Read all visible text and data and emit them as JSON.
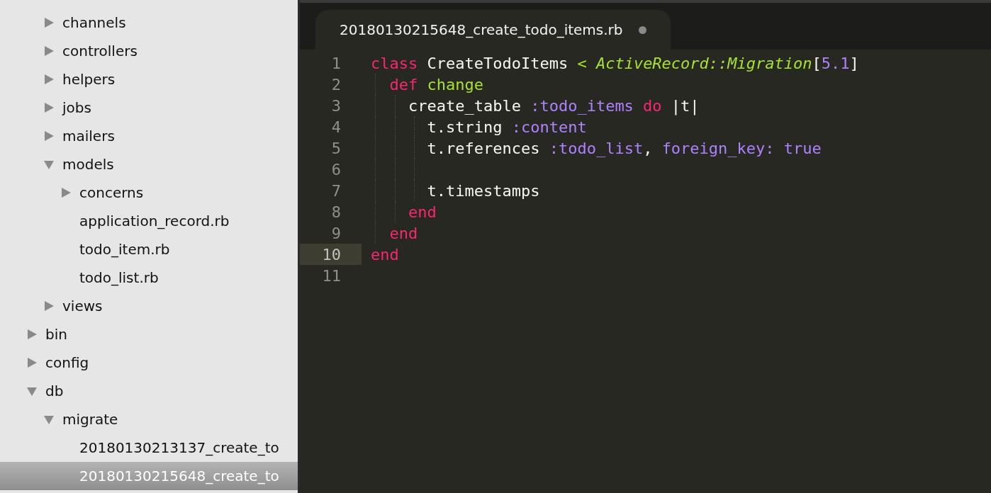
{
  "sidebar": {
    "tree": [
      {
        "children": [
          {
            "label": "channels",
            "kind": "folder",
            "expanded": false,
            "selected": false
          },
          {
            "label": "controllers",
            "kind": "folder",
            "expanded": false,
            "selected": false
          },
          {
            "label": "helpers",
            "kind": "folder",
            "expanded": false,
            "selected": false
          },
          {
            "label": "jobs",
            "kind": "folder",
            "expanded": false,
            "selected": false
          },
          {
            "label": "mailers",
            "kind": "folder",
            "expanded": false,
            "selected": false
          },
          {
            "label": "models",
            "kind": "folder",
            "expanded": true,
            "selected": false,
            "children": [
              {
                "label": "concerns",
                "kind": "folder",
                "expanded": false,
                "selected": false
              },
              {
                "label": "application_record.rb",
                "kind": "file",
                "selected": false
              },
              {
                "label": "todo_item.rb",
                "kind": "file",
                "selected": false
              },
              {
                "label": "todo_list.rb",
                "kind": "file",
                "selected": false
              }
            ]
          },
          {
            "label": "views",
            "kind": "folder",
            "expanded": false,
            "selected": false
          }
        ]
      },
      {
        "label": "bin",
        "kind": "folder",
        "expanded": false,
        "selected": false
      },
      {
        "label": "config",
        "kind": "folder",
        "expanded": false,
        "selected": false
      },
      {
        "label": "db",
        "kind": "folder",
        "expanded": true,
        "selected": false,
        "children": [
          {
            "label": "migrate",
            "kind": "folder",
            "expanded": true,
            "selected": false,
            "children": [
              {
                "label": "20180130213137_create_to",
                "kind": "file",
                "selected": false
              },
              {
                "label": "20180130215648_create_to",
                "kind": "file",
                "selected": true
              }
            ]
          }
        ]
      }
    ]
  },
  "tab": {
    "title": "20180130215648_create_todo_items.rb",
    "modified": true
  },
  "editor": {
    "lines": [
      {
        "number": "1",
        "current": false,
        "tokens": [
          {
            "kind": "keyword",
            "text": "class"
          },
          {
            "kind": "plain",
            "text": " CreateTodoItems "
          },
          {
            "kind": "entity",
            "text": "<"
          },
          {
            "kind": "inherit",
            "text": " ActiveRecord::Migration"
          },
          {
            "kind": "plain",
            "text": "["
          },
          {
            "kind": "constant",
            "text": "5.1"
          },
          {
            "kind": "plain",
            "text": "]"
          }
        ]
      },
      {
        "number": "2",
        "current": false,
        "tokens": [
          {
            "kind": "keyword",
            "text": "  def"
          },
          {
            "kind": "entity",
            "text": " change"
          }
        ]
      },
      {
        "number": "3",
        "current": false,
        "tokens": [
          {
            "kind": "plain",
            "text": "    create_table "
          },
          {
            "kind": "constant",
            "text": ":todo_items"
          },
          {
            "kind": "keyword",
            "text": " do"
          },
          {
            "kind": "plain",
            "text": " |t|"
          }
        ]
      },
      {
        "number": "4",
        "current": false,
        "tokens": [
          {
            "kind": "plain",
            "text": "      t.string "
          },
          {
            "kind": "constant",
            "text": ":content"
          }
        ]
      },
      {
        "number": "5",
        "current": false,
        "tokens": [
          {
            "kind": "plain",
            "text": "      t.references "
          },
          {
            "kind": "constant",
            "text": ":todo_list"
          },
          {
            "kind": "plain",
            "text": ", "
          },
          {
            "kind": "constant",
            "text": "foreign_key: true"
          }
        ]
      },
      {
        "number": "6",
        "current": false
      },
      {
        "number": "7",
        "current": false,
        "tokens": [
          {
            "kind": "plain",
            "text": "      t.timestamps"
          }
        ]
      },
      {
        "number": "8",
        "current": false,
        "tokens": [
          {
            "kind": "keyword",
            "text": "    end"
          }
        ]
      },
      {
        "number": "9",
        "current": false,
        "tokens": [
          {
            "kind": "keyword",
            "text": "  end"
          }
        ]
      },
      {
        "number": "10",
        "current": true,
        "tokens": [
          {
            "kind": "keyword",
            "text": "end"
          }
        ]
      },
      {
        "number": "11",
        "current": false
      }
    ]
  }
}
